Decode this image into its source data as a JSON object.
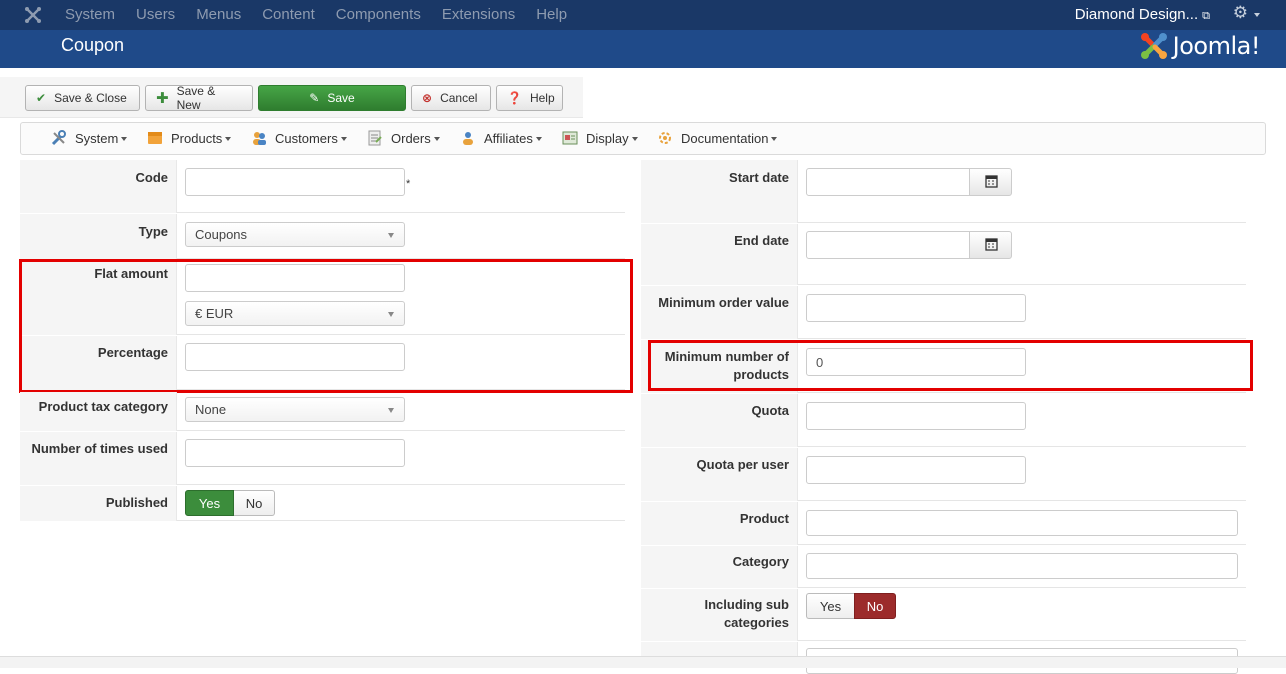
{
  "navbar": {
    "menu": [
      "System",
      "Users",
      "Menus",
      "Content",
      "Components",
      "Extensions",
      "Help"
    ],
    "site_link": "Diamond Design...",
    "bg_color": "#1a3867"
  },
  "header": {
    "title": "Coupon",
    "brand": "Joomla!"
  },
  "toolbar": {
    "save_close": "Save & Close",
    "save_new": "Save & New",
    "save": "Save",
    "cancel": "Cancel",
    "help": "Help"
  },
  "component_menu": [
    {
      "label": "System",
      "icon": "tools-icon"
    },
    {
      "label": "Products",
      "icon": "box-icon"
    },
    {
      "label": "Customers",
      "icon": "users-icon"
    },
    {
      "label": "Orders",
      "icon": "orders-icon"
    },
    {
      "label": "Affiliates",
      "icon": "affiliates-icon"
    },
    {
      "label": "Display",
      "icon": "display-icon"
    },
    {
      "label": "Documentation",
      "icon": "documentation-icon"
    }
  ],
  "form_left": {
    "code": {
      "label": "Code",
      "value": "",
      "required_mark": "*"
    },
    "type": {
      "label": "Type",
      "value": "Coupons"
    },
    "flat_amount": {
      "label": "Flat amount",
      "value": "",
      "currency": "€ EUR"
    },
    "percentage": {
      "label": "Percentage",
      "value": ""
    },
    "product_tax_category": {
      "label": "Product tax category",
      "value": "None"
    },
    "times_used": {
      "label": "Number of times used",
      "value": ""
    },
    "published": {
      "label": "Published",
      "yes": "Yes",
      "no": "No",
      "selected": "Yes"
    }
  },
  "form_right": {
    "start_date": {
      "label": "Start date",
      "value": ""
    },
    "end_date": {
      "label": "End date",
      "value": ""
    },
    "min_order_value": {
      "label": "Minimum order value",
      "value": ""
    },
    "min_products": {
      "label_1": "Minimum number of",
      "label_2": "products",
      "value": "0"
    },
    "quota": {
      "label": "Quota",
      "value": ""
    },
    "quota_per_user": {
      "label": "Quota per user",
      "value": ""
    },
    "product": {
      "label": "Product",
      "value": ""
    },
    "category": {
      "label": "Category",
      "value": ""
    },
    "including_sub": {
      "label_1": "Including sub",
      "label_2": "categories",
      "yes": "Yes",
      "no": "No",
      "selected": "No"
    }
  },
  "colors": {
    "highlight": "#e30000",
    "green": "#3c8d3c",
    "red": "#9c2b2b"
  }
}
